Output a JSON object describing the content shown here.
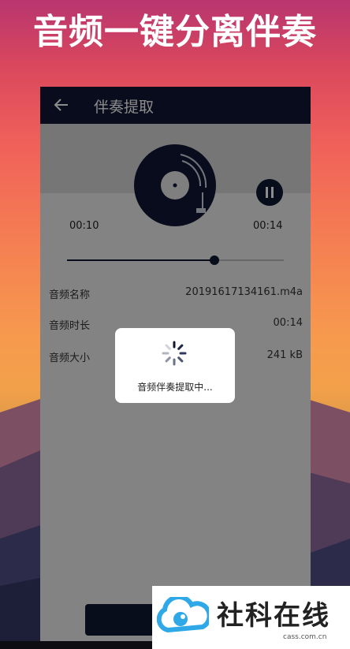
{
  "poster": {
    "headline": "音频一键分离伴奏"
  },
  "app_bar": {
    "title": "伴奏提取",
    "back_icon": "arrow-left-icon"
  },
  "player": {
    "current_time": "00:10",
    "total_time": "00:14",
    "progress": 0.68,
    "pause_icon": "pause-icon",
    "disc_icon": "vinyl-record-icon"
  },
  "info": {
    "name_label": "音频名称",
    "name_value": "20191617134161.m4a",
    "duration_label": "音频时长",
    "duration_value": "00:14",
    "size_label": "音频大小",
    "size_value": "241 kB"
  },
  "dialog": {
    "text": "音频伴奏提取中..."
  },
  "watermark": {
    "brand": "社科在线",
    "domain": "cass.com.cn"
  },
  "colors": {
    "app_primary": "#0f1733",
    "dialog_bg": "#ffffff",
    "logo_blue": "#2fa8e8"
  }
}
